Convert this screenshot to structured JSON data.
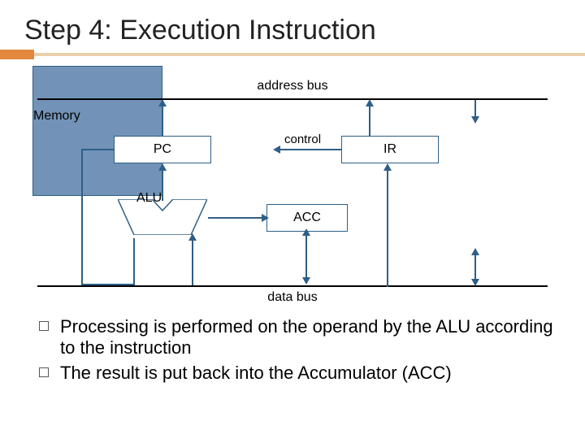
{
  "slide": {
    "title": "Step 4: Execution Instruction"
  },
  "diagram": {
    "address_bus_label": "address  bus",
    "data_bus_label": "data  bus",
    "control_label": "control",
    "boxes": {
      "pc": "PC",
      "ir": "IR",
      "acc": "ACC",
      "alu": "ALU",
      "memory": "Memory"
    }
  },
  "bullets": [
    "Processing is performed on the operand by the ALU according to the instruction",
    "The result is put back into the Accumulator (ACC)"
  ],
  "colors": {
    "accent_block": "#e2893e",
    "accent_line": "#e8d0a9",
    "box_border": "#2e5f87",
    "memory_fill": "#7293b7"
  }
}
